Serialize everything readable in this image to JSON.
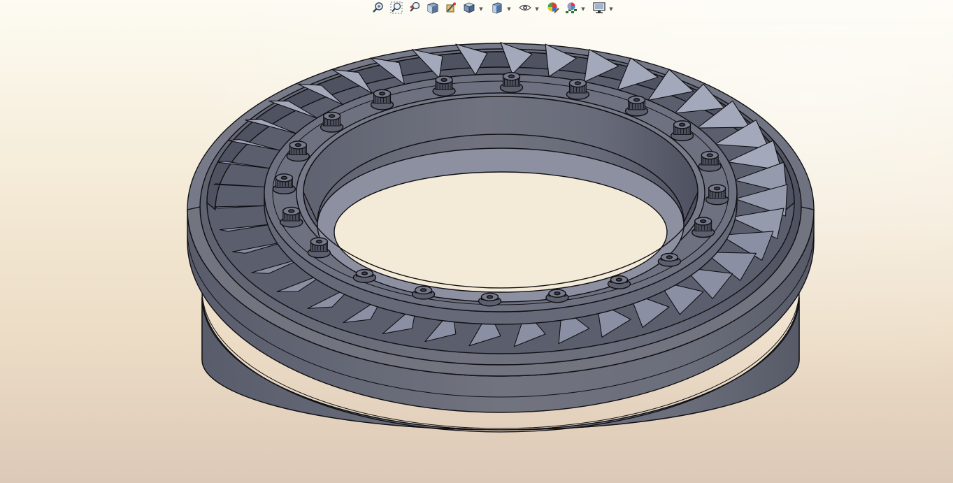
{
  "viewport": {
    "background_top": "#fdfbf2",
    "background_bottom": "#dcc9b8"
  },
  "toolbar": {
    "buttons": [
      {
        "icon": "zoom-to-fit-icon"
      },
      {
        "icon": "zoom-to-area-icon"
      },
      {
        "icon": "previous-view-icon"
      },
      {
        "icon": "section-view-icon"
      },
      {
        "icon": "dynamic-annotation-views-icon"
      },
      {
        "icon": "view-orientation-icon",
        "dropdown": true
      },
      {
        "icon": "display-style-icon",
        "dropdown": true
      },
      {
        "icon": "hide-show-items-icon",
        "dropdown": true
      },
      {
        "icon": "edit-appearance-icon"
      },
      {
        "icon": "apply-scene-icon",
        "dropdown": true
      },
      {
        "icon": "view-settings-icon",
        "dropdown": true
      }
    ]
  },
  "model": {
    "description_visible": false,
    "body_color": "#6d7180",
    "edge_color": "#101014",
    "vane_count": 40,
    "bolt_count": 20
  }
}
